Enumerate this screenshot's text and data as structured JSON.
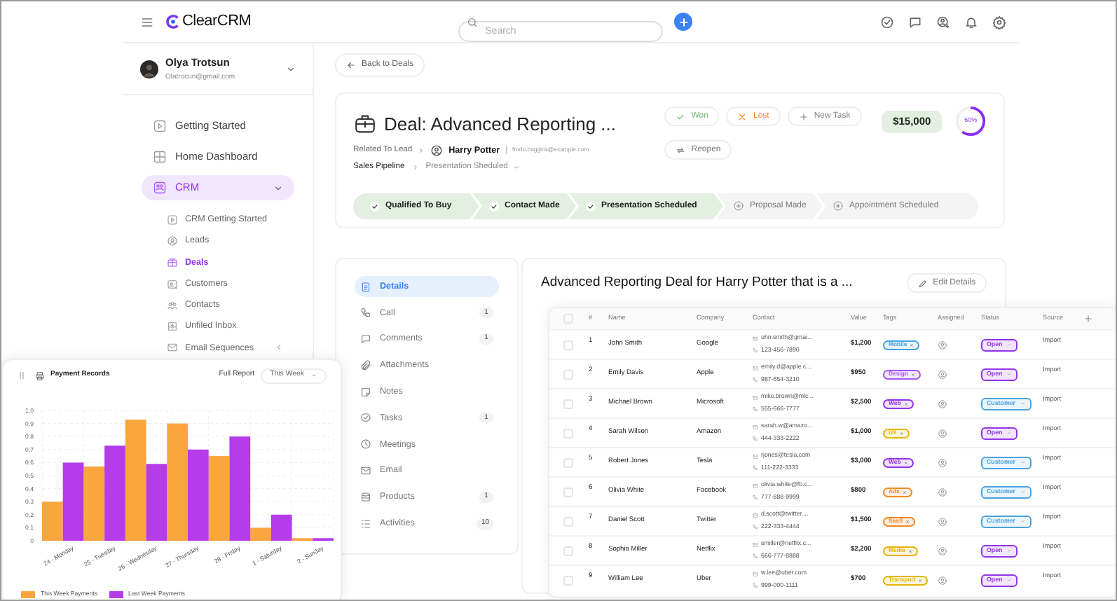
{
  "app": {
    "logo": "ClearCRM",
    "search": {
      "placeholder": "Search"
    }
  },
  "user": {
    "name": "Olya Trotsun",
    "email": "Olatrocun@gmail.com"
  },
  "nav": [
    {
      "label": "Getting Started",
      "kind": "link",
      "selected": false
    },
    {
      "label": "Home Dashboard",
      "kind": "link",
      "selected": false
    },
    {
      "label": "CRM",
      "kind": "group",
      "expanded": true,
      "selected": true,
      "children": [
        {
          "label": "CRM Getting Started",
          "kind": "link",
          "selected": false
        },
        {
          "label": "Leads",
          "kind": "link",
          "selected": false
        },
        {
          "label": "Deals",
          "kind": "link",
          "selected": true
        },
        {
          "label": "Customers",
          "kind": "link",
          "selected": false
        },
        {
          "label": "Contacts",
          "kind": "link",
          "selected": false
        },
        {
          "label": "Unfiled Inbox",
          "kind": "link",
          "selected": false
        },
        {
          "label": "Email Sequences",
          "kind": "group",
          "expanded": false,
          "selected": false
        }
      ]
    }
  ],
  "deal": {
    "back": "Back to Deals",
    "title": "Deal: Advanced Reporting ...",
    "related_label": "Related To Lead",
    "lead_name": "Harry Potter",
    "lead_email": "frodo.baggins@example.com",
    "pipeline_label": "Sales Pipeline",
    "pipeline_value": "Presentation Sheduled",
    "actions": [
      {
        "label": "Won",
        "kind": "won"
      },
      {
        "label": "Lost",
        "kind": "lost"
      },
      {
        "label": "New Task",
        "kind": "add"
      },
      {
        "label": "Reopen",
        "kind": "reopen"
      }
    ],
    "amount": "$15,000",
    "progress": {
      "level": 0.6,
      "label": "60%"
    },
    "stages": [
      {
        "label": "Qualified To Buy",
        "done": true
      },
      {
        "label": "Contact Made",
        "done": true
      },
      {
        "label": "Presentation Scheduled",
        "done": true
      },
      {
        "label": "Proposal Made",
        "done": false
      },
      {
        "label": "Appointment Scheduled",
        "done": false
      }
    ]
  },
  "sections": [
    {
      "label": "Details",
      "selected": true
    },
    {
      "label": "Call",
      "selected": false,
      "count": "1"
    },
    {
      "label": "Comments",
      "selected": false,
      "count": "1"
    },
    {
      "label": "Attachments",
      "selected": false
    },
    {
      "label": "Notes",
      "selected": false
    },
    {
      "label": "Tasks",
      "selected": false,
      "count": "1"
    },
    {
      "label": "Meetings",
      "selected": false
    },
    {
      "label": "Email",
      "selected": false
    },
    {
      "label": "Products",
      "selected": false,
      "count": "1"
    },
    {
      "label": "Activities",
      "selected": false,
      "count": "10"
    }
  ],
  "detail": {
    "title": "Advanced Reporting Deal for Harry Potter that is a ...",
    "edit": "Edit Details"
  },
  "table": {
    "all_checked": false,
    "columns": [
      "#",
      "Name",
      "Company",
      "Contact",
      "Value",
      "Tags",
      "Assigned",
      "Status",
      "Source"
    ],
    "rows": [
      {
        "checked": false,
        "number": "1",
        "name": "John Smith",
        "company": "Google",
        "email": "ohn.smith@gmai...",
        "phone": "123-456-7890",
        "value": "$1,200",
        "tag": {
          "label": "Mobile",
          "color": "#4aa3df"
        },
        "status": {
          "label": "Open",
          "color": "#9333ea"
        },
        "source": "Import"
      },
      {
        "checked": false,
        "number": "2",
        "name": "Emily Davis",
        "company": "Apple",
        "email": "emily.d@apple.c...",
        "phone": "987-654-3210",
        "value": "$950",
        "tag": {
          "label": "Design",
          "color": "#a855f7"
        },
        "status": {
          "label": "Open",
          "color": "#9333ea"
        },
        "source": "Import"
      },
      {
        "checked": false,
        "number": "3",
        "name": "Michael Brown",
        "company": "Microsoft",
        "email": "mike.brown@mic...",
        "phone": "555-666-7777",
        "value": "$2,500",
        "tag": {
          "label": "Web",
          "color": "#9333ea"
        },
        "status": {
          "label": "Customer",
          "color": "#4aa3df"
        },
        "source": "Import"
      },
      {
        "checked": false,
        "number": "4",
        "name": "Sarah Wilson",
        "company": "Amazon",
        "email": "sarah.w@amazo...",
        "phone": "444-333-2222",
        "value": "$1,000",
        "tag": {
          "label": "UX",
          "color": "#e5b400"
        },
        "status": {
          "label": "Open",
          "color": "#9333ea"
        },
        "source": "Import"
      },
      {
        "checked": false,
        "number": "5",
        "name": "Robert Jones",
        "company": "Tesla",
        "email": "rjones@tesla.com",
        "phone": "111-222-3333",
        "value": "$3,000",
        "tag": {
          "label": "Web",
          "color": "#9333ea"
        },
        "status": {
          "label": "Customer",
          "color": "#4aa3df"
        },
        "source": "Import"
      },
      {
        "checked": false,
        "number": "6",
        "name": "Olivia White",
        "company": "Facebook",
        "email": "olivia.white@fb.c...",
        "phone": "777-888-9999",
        "value": "$800",
        "tag": {
          "label": "Ads",
          "color": "#f08a24"
        },
        "status": {
          "label": "Customer",
          "color": "#4aa3df"
        },
        "source": "Import"
      },
      {
        "checked": false,
        "number": "7",
        "name": "Daniel Scott",
        "company": "Twitter",
        "email": "d.scott@twitter....",
        "phone": "222-333-4444",
        "value": "$1,500",
        "tag": {
          "label": "SaaS",
          "color": "#f08a24"
        },
        "status": {
          "label": "Customer",
          "color": "#4aa3df"
        },
        "source": "Import"
      },
      {
        "checked": false,
        "number": "8",
        "name": "Sophia Miller",
        "company": "Netflix",
        "email": "smiller@netflix.c...",
        "phone": "666-777-8888",
        "value": "$2,200",
        "tag": {
          "label": "Media",
          "color": "#e5b400"
        },
        "status": {
          "label": "Open",
          "color": "#9333ea"
        },
        "source": "Import"
      },
      {
        "checked": false,
        "number": "9",
        "name": "William Lee",
        "company": "Uber",
        "email": "w.lee@uber.com",
        "phone": "999-000-1111",
        "value": "$700",
        "tag": {
          "label": "Transport",
          "color": "#e5b400"
        },
        "status": {
          "label": "Open",
          "color": "#9333ea"
        },
        "source": "Import"
      }
    ]
  },
  "payments": {
    "title": "Payment Records",
    "full_report": "Full Report",
    "period": "This Week",
    "chart_data": {
      "type": "bar",
      "grid": true,
      "categories": [
        "24 - Monday",
        "25 - Tuesday",
        "26 - Wednesday",
        "27 - Thursday",
        "28 - Friday",
        "1 - Saturday",
        "2 - Sunday"
      ],
      "series": [
        {
          "name": "This Week Payments",
          "color": "#fba53f",
          "values": [
            0.3,
            0.57,
            0.93,
            0.9,
            0.65,
            0.1,
            0.02
          ]
        },
        {
          "name": "Last Week Payments",
          "color": "#b43ce9",
          "values": [
            0.6,
            0.73,
            0.59,
            0.7,
            0.8,
            0.2,
            0.02
          ]
        }
      ],
      "ylim": [
        0,
        1
      ],
      "yticks": [
        {
          "value": 0,
          "label": "0"
        },
        {
          "value": 0.1,
          "label": "0.1"
        },
        {
          "value": 0.2,
          "label": "0.2"
        },
        {
          "value": 0.3,
          "label": "0.3"
        },
        {
          "value": 0.4,
          "label": "0.4"
        },
        {
          "value": 0.5,
          "label": "0.5"
        },
        {
          "value": 0.6,
          "label": "0.6"
        },
        {
          "value": 0.7,
          "label": "0.7"
        },
        {
          "value": 0.8,
          "label": "0.8"
        },
        {
          "value": 0.9,
          "label": "0.9"
        },
        {
          "value": 1,
          "label": "1.0"
        }
      ]
    }
  }
}
